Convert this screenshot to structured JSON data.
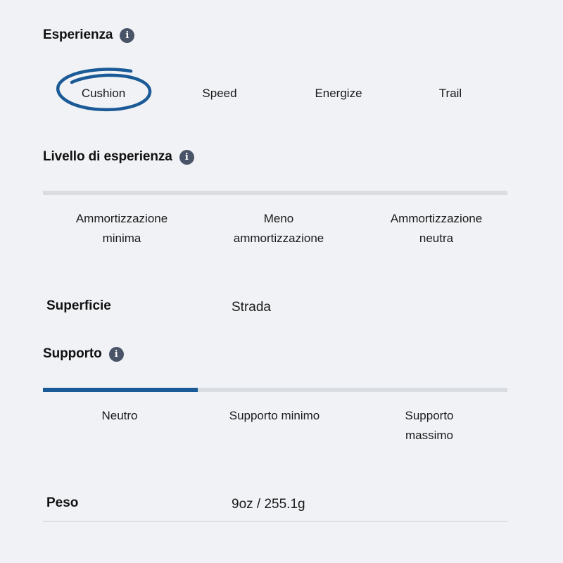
{
  "experience": {
    "title": "Esperienza",
    "info_icon": "info-icon",
    "options": [
      "Cushion",
      "Speed",
      "Energize",
      "Trail"
    ],
    "selected": "Cushion",
    "highlight_color": "#1a5a96"
  },
  "experience_level": {
    "title": "Livello di esperienza",
    "info_icon": "info-icon",
    "options": [
      "Ammortizzazione\nminima",
      "Meno\nammortizzazione",
      "Ammortizzazione\nneutra"
    ],
    "level": 0
  },
  "surface": {
    "label": "Superficie",
    "value": "Strada"
  },
  "support": {
    "title": "Supporto",
    "info_icon": "info-icon",
    "options": [
      "Neutro",
      "Supporto minimo",
      "Supporto\nmassimo"
    ],
    "level": 0.333,
    "bar_color": "#1a5a96"
  },
  "weight": {
    "label": "Peso",
    "value": "9oz / 255.1g"
  }
}
